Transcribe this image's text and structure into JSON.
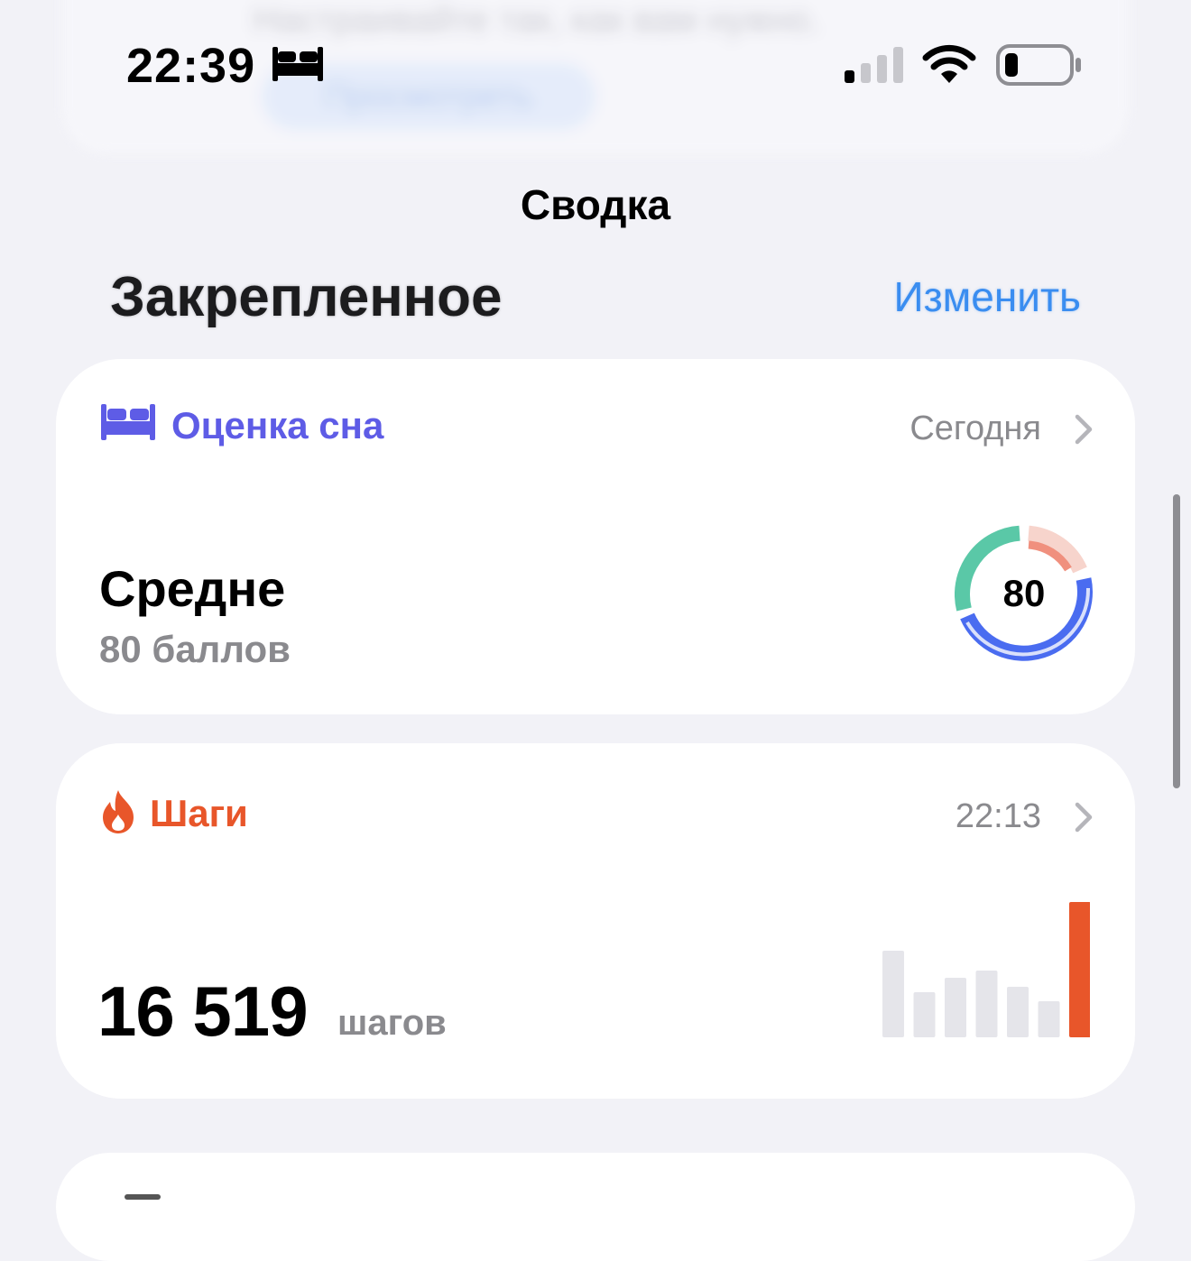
{
  "status_bar": {
    "time": "22:39",
    "focus_icon": "bed-icon",
    "signal_icon": "cellular-signal-icon",
    "wifi_icon": "wifi-icon",
    "battery_icon": "battery-low-icon"
  },
  "banner": {
    "text": "Настраивайте так, как вам нужно.",
    "button_label": "Просмотреть"
  },
  "nav": {
    "title": "Сводка"
  },
  "pinned": {
    "title": "Закрепленное",
    "edit_label": "Изменить"
  },
  "sleep_card": {
    "icon": "bed-icon",
    "title": "Оценка сна",
    "date": "Сегодня",
    "level": "Средне",
    "points": "80 баллов",
    "score": "80",
    "title_color": "#5e5ce6",
    "ring_colors": [
      "#5ac8a7",
      "#f0907e",
      "#4a6cf0"
    ]
  },
  "steps_card": {
    "icon": "flame-icon",
    "title": "Шаги",
    "time": "22:13",
    "value": "16 519",
    "unit": "шагов",
    "accent_color": "#e8562a",
    "chart_data": {
      "type": "bar",
      "values": [
        96,
        50,
        66,
        74,
        56,
        40,
        150
      ],
      "highlight_index": 6
    }
  }
}
